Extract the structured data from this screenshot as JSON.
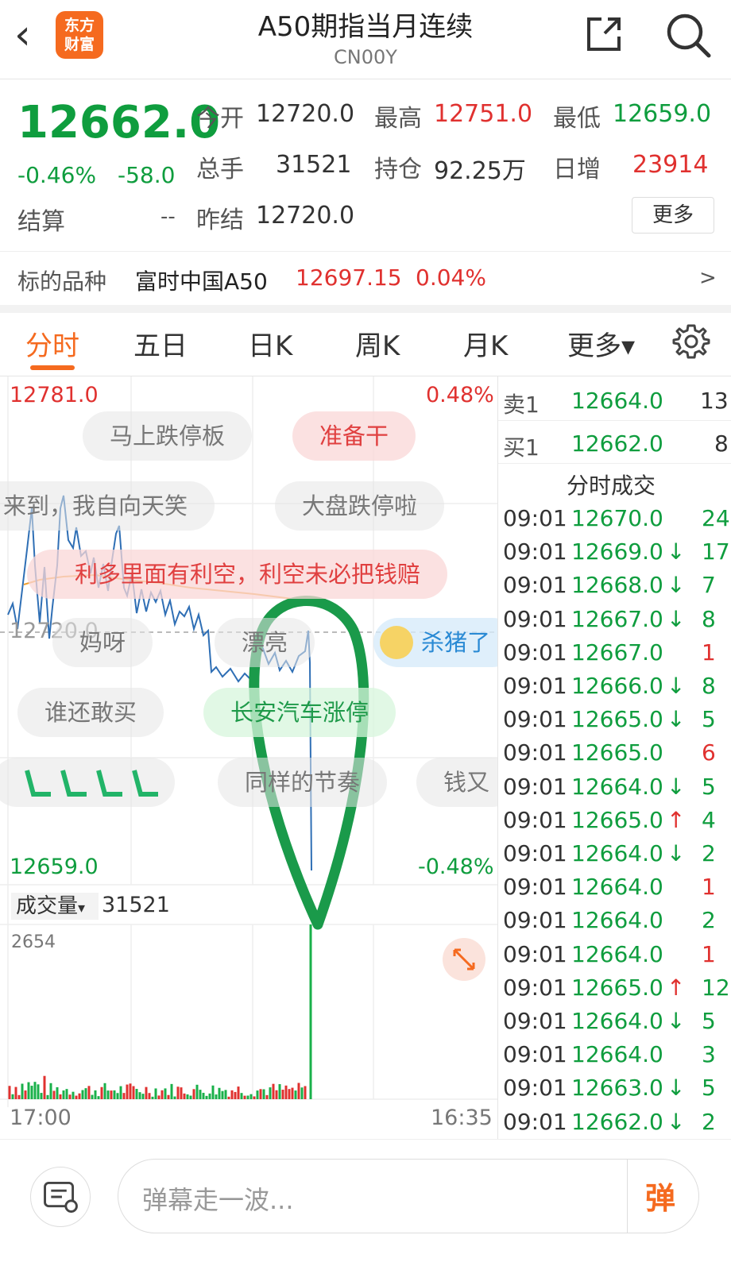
{
  "header": {
    "back_glyph": "‹",
    "logo_line1": "东方",
    "logo_line2": "财富",
    "title": "A50期指当月连续",
    "code": "CN00Y"
  },
  "quote": {
    "price": "12662.0",
    "change_pct": "-0.46%",
    "change_abs": "-58.0",
    "open_label": "今开",
    "open_value": "12720.0",
    "high_label": "最高",
    "high_value": "12751.0",
    "low_label": "最低",
    "low_value": "12659.0",
    "volume_label": "总手",
    "volume_value": "31521",
    "oi_label": "持仓",
    "oi_value": "92.25万",
    "daily_inc_label": "日增",
    "daily_inc_value": "23914",
    "settle_label": "结算",
    "settle_value": "--",
    "prev_settle_label": "昨结",
    "prev_settle_value": "12720.0",
    "more_label": "更多"
  },
  "underlying": {
    "label": "标的品种",
    "name": "富时中国A50",
    "price": "12697.15",
    "pct": "0.04%",
    "arrow": ">"
  },
  "tabs": [
    {
      "label": "分时",
      "active": true
    },
    {
      "label": "五日"
    },
    {
      "label": "日K"
    },
    {
      "label": "周K"
    },
    {
      "label": "月K"
    },
    {
      "label": "更多▾"
    }
  ],
  "chart": {
    "top_price": "12781.0",
    "top_pct": "0.48%",
    "bottom_price": "12659.0",
    "bottom_pct": "-0.48%",
    "mid_price": "12720.0",
    "volume_label": "成交量",
    "volume_dropdown": "▾",
    "volume_total": "31521",
    "volume_max": "2654",
    "time_start": "17:00",
    "time_end": "16:35"
  },
  "danmu": [
    "马上跌停板",
    "准备干",
    "来到，我自向天笑",
    "大盘跌停啦",
    "利多里面有利空，利空未必把钱赔",
    "妈呀",
    "漂亮",
    "杀猪了",
    "谁还敢买",
    "长安汽车涨停",
    "同样的节奏",
    "钱又"
  ],
  "colors": {
    "accent": "#f56a1f",
    "down": "#0f9d3e",
    "up": "#e0312f",
    "line": "#2f6fb5",
    "avg": "#f0a030"
  },
  "book": {
    "sell_label": "卖1",
    "sell_price": "12664.0",
    "sell_qty": "13",
    "buy_label": "买1",
    "buy_price": "12662.0",
    "buy_qty": "8",
    "trades_title": "分时成交",
    "trades": [
      {
        "time": "09:01",
        "price": "12670.0",
        "arrow": "",
        "qty": "24",
        "dir": "down"
      },
      {
        "time": "09:01",
        "price": "12669.0",
        "arrow": "↓",
        "qty": "17",
        "dir": "down"
      },
      {
        "time": "09:01",
        "price": "12668.0",
        "arrow": "↓",
        "qty": "7",
        "dir": "down"
      },
      {
        "time": "09:01",
        "price": "12667.0",
        "arrow": "↓",
        "qty": "8",
        "dir": "down"
      },
      {
        "time": "09:01",
        "price": "12667.0",
        "arrow": "",
        "qty": "1",
        "dir": "up"
      },
      {
        "time": "09:01",
        "price": "12666.0",
        "arrow": "↓",
        "qty": "8",
        "dir": "down"
      },
      {
        "time": "09:01",
        "price": "12665.0",
        "arrow": "↓",
        "qty": "5",
        "dir": "down"
      },
      {
        "time": "09:01",
        "price": "12665.0",
        "arrow": "",
        "qty": "6",
        "dir": "up"
      },
      {
        "time": "09:01",
        "price": "12664.0",
        "arrow": "↓",
        "qty": "5",
        "dir": "down"
      },
      {
        "time": "09:01",
        "price": "12665.0",
        "arrow": "↑",
        "qty": "4",
        "dir": "down"
      },
      {
        "time": "09:01",
        "price": "12664.0",
        "arrow": "↓",
        "qty": "2",
        "dir": "down"
      },
      {
        "time": "09:01",
        "price": "12664.0",
        "arrow": "",
        "qty": "1",
        "dir": "up"
      },
      {
        "time": "09:01",
        "price": "12664.0",
        "arrow": "",
        "qty": "2",
        "dir": "down"
      },
      {
        "time": "09:01",
        "price": "12664.0",
        "arrow": "",
        "qty": "1",
        "dir": "up"
      },
      {
        "time": "09:01",
        "price": "12665.0",
        "arrow": "↑",
        "qty": "12",
        "dir": "down"
      },
      {
        "time": "09:01",
        "price": "12664.0",
        "arrow": "↓",
        "qty": "5",
        "dir": "down"
      },
      {
        "time": "09:01",
        "price": "12664.0",
        "arrow": "",
        "qty": "3",
        "dir": "down"
      },
      {
        "time": "09:01",
        "price": "12663.0",
        "arrow": "↓",
        "qty": "5",
        "dir": "down"
      },
      {
        "time": "09:01",
        "price": "12662.0",
        "arrow": "↓",
        "qty": "2",
        "dir": "down"
      }
    ]
  },
  "bottom": {
    "input_placeholder": "弹幕走一波...",
    "danmu_button": "弹"
  }
}
